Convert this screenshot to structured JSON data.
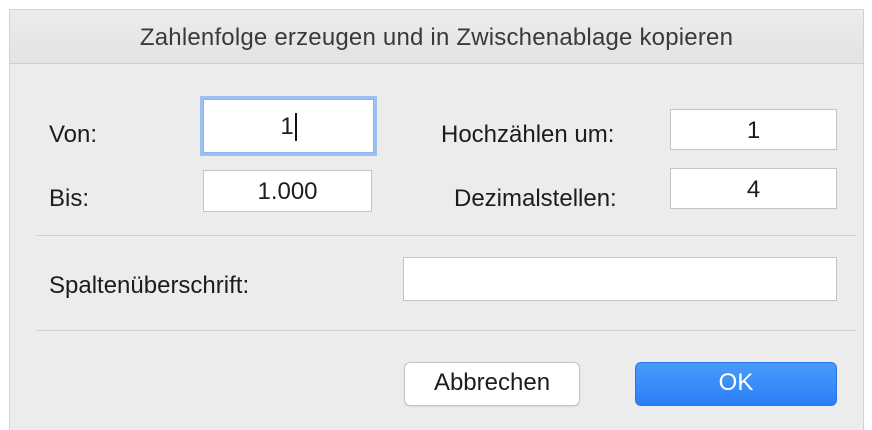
{
  "dialog": {
    "title": "Zahlenfolge erzeugen und in Zwischenablage kopieren"
  },
  "fields": {
    "von": {
      "label": "Von:",
      "value": "1"
    },
    "bis": {
      "label": "Bis:",
      "value": "1.000"
    },
    "step": {
      "label": "Hochzählen um:",
      "value": "1"
    },
    "decimals": {
      "label": "Dezimalstellen:",
      "value": "4"
    },
    "header": {
      "label": "Spaltenüberschrift:",
      "value": ""
    }
  },
  "buttons": {
    "cancel": "Abbrechen",
    "ok": "OK"
  },
  "colors": {
    "dialog_bg": "#ececec",
    "focus_ring": "#9cc0f2",
    "ok_button": "#2b7ff5"
  }
}
